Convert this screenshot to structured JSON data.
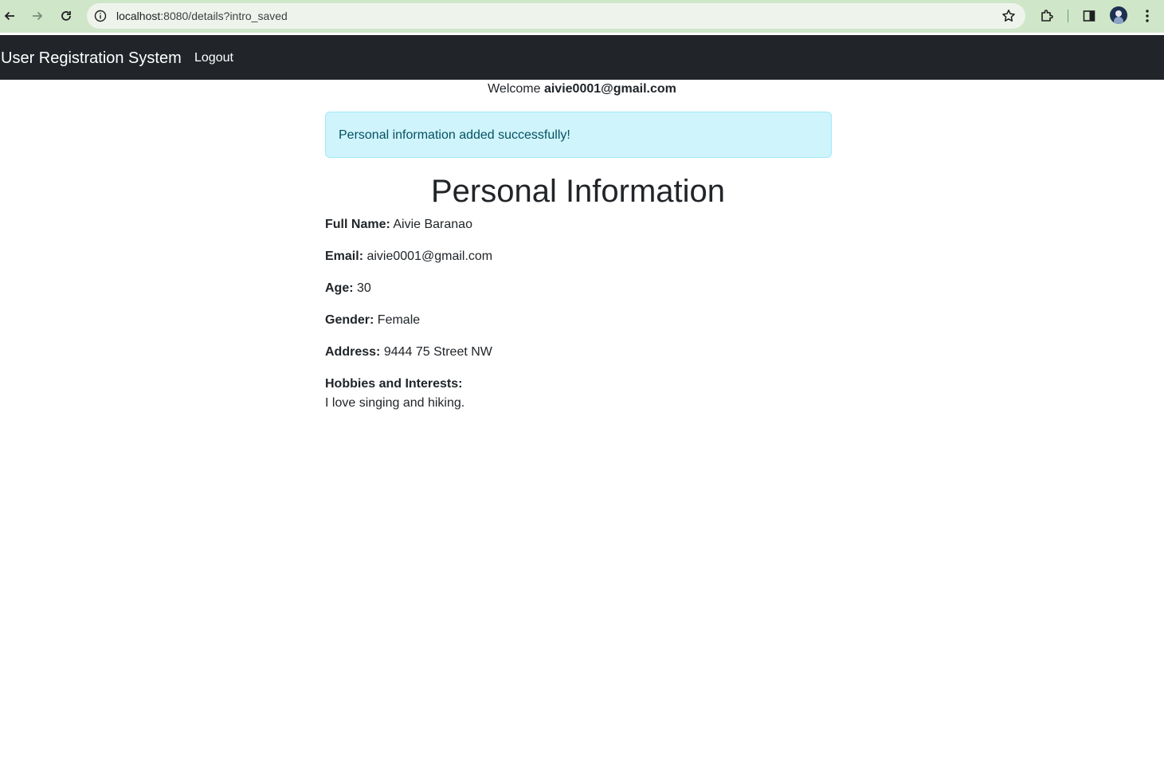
{
  "browser": {
    "url_host": "localhost",
    "url_rest": ":8080/details?intro_saved",
    "icons": [
      "back-arrow-icon",
      "forward-arrow-icon",
      "reload-icon",
      "site-info-icon",
      "bookmark-star-icon",
      "extensions-puzzle-icon",
      "side-panel-icon",
      "profile-avatar-icon",
      "more-menu-icon"
    ]
  },
  "navbar": {
    "brand": "User Registration System",
    "logout_label": "Logout"
  },
  "welcome": {
    "prefix": "Welcome",
    "email": "aivie0001@gmail.com"
  },
  "alert": {
    "message": "Personal information added successfully!",
    "color": "#cff4fc"
  },
  "page": {
    "title": "Personal Information"
  },
  "fields": {
    "full_name": {
      "label": "Full Name:",
      "value": "Aivie Baranao"
    },
    "email": {
      "label": "Email:",
      "value": "aivie0001@gmail.com"
    },
    "age": {
      "label": "Age:",
      "value": "30"
    },
    "gender": {
      "label": "Gender:",
      "value": "Female"
    },
    "address": {
      "label": "Address:",
      "value": "9444 75 Street NW"
    },
    "hobbies": {
      "label": "Hobbies and Interests:",
      "value": "I love singing and hiking."
    }
  },
  "colors": {
    "navbar_bg": "#212529",
    "browser_bar": "#cfe6c9"
  }
}
